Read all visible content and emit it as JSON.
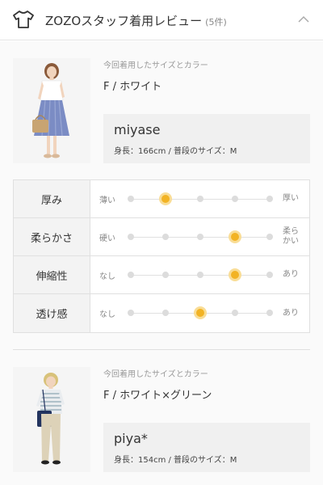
{
  "header": {
    "title": "ZOZOスタッフ着用レビュー",
    "count": "(5件)",
    "icon": "shirt-icon",
    "toggle_icon": "chevron-up-icon"
  },
  "reviews": [
    {
      "size_label": "今回着用したサイズとカラー",
      "size_color": "F / ホワイト",
      "user_name": "miyase",
      "user_info": "身長：166cm / 普段のサイズ：M",
      "metrics": [
        {
          "name": "厚み",
          "low": "薄い",
          "high": "厚い",
          "level": 2,
          "steps": 5
        },
        {
          "name": "柔らかさ",
          "low": "硬い",
          "high": "柔らかい",
          "level": 4,
          "steps": 5
        },
        {
          "name": "伸縮性",
          "low": "なし",
          "high": "あり",
          "level": 4,
          "steps": 5
        },
        {
          "name": "透け感",
          "low": "なし",
          "high": "あり",
          "level": 3,
          "steps": 5
        }
      ]
    },
    {
      "size_label": "今回着用したサイズとカラー",
      "size_color": "F / ホワイト×グリーン",
      "user_name": "piya*",
      "user_info": "身長：154cm / 普段のサイズ：M"
    }
  ],
  "colors": {
    "accent": "#f2b324",
    "accent_ring": "#f9dd96"
  }
}
